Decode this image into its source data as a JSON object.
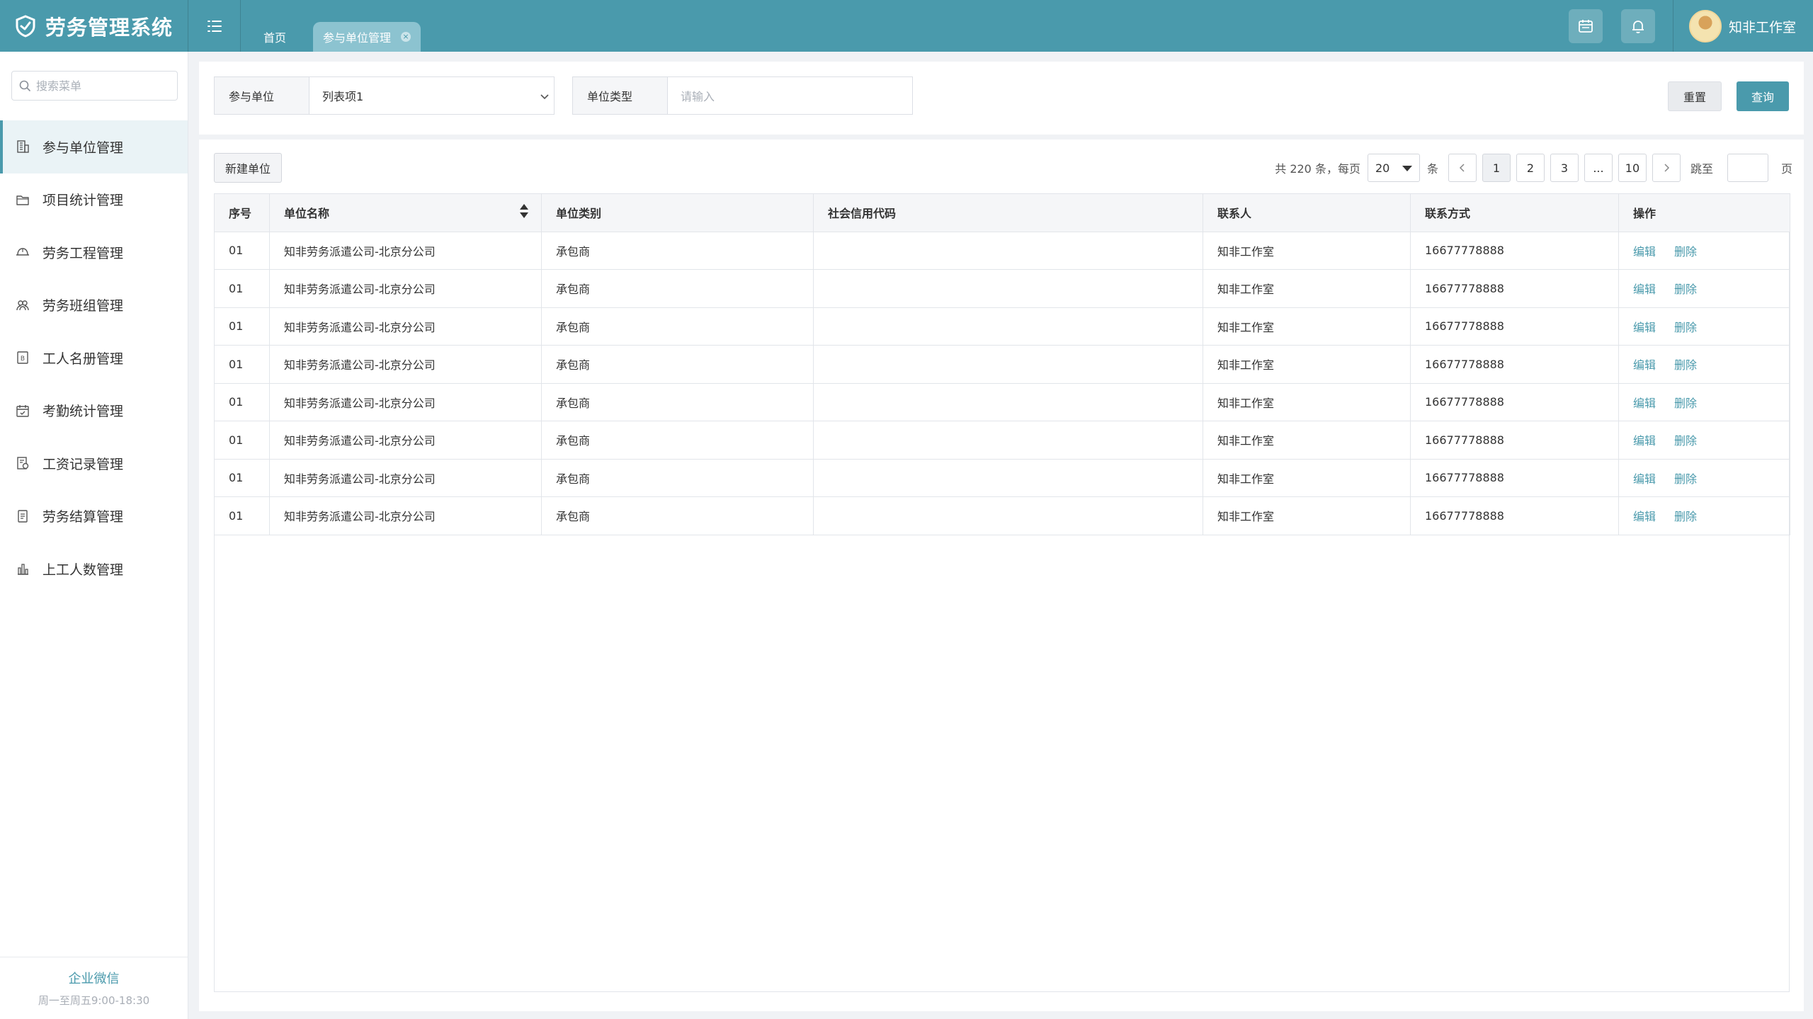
{
  "app": {
    "title": "劳务管理系统",
    "brand_color": "#4a9aac"
  },
  "header": {
    "tabs": [
      {
        "label": "首页",
        "active": false
      },
      {
        "label": "参与单位管理",
        "active": true,
        "close_icon": "close-circle-icon"
      }
    ],
    "icons": [
      "calendar-icon",
      "bell-icon"
    ],
    "user": {
      "name": "知非工作室"
    }
  },
  "sidebar": {
    "search_placeholder": "搜索菜单",
    "items": [
      {
        "label": "参与单位管理",
        "icon": "building-icon",
        "active": true
      },
      {
        "label": "项目统计管理",
        "icon": "folder-icon"
      },
      {
        "label": "劳务工程管理",
        "icon": "hard-hat-icon"
      },
      {
        "label": "劳务班组管理",
        "icon": "team-icon"
      },
      {
        "label": "工人名册管理",
        "icon": "roster-icon"
      },
      {
        "label": "考勤统计管理",
        "icon": "calendar-check-icon"
      },
      {
        "label": "工资记录管理",
        "icon": "payroll-icon"
      },
      {
        "label": "劳务结算管理",
        "icon": "document-icon"
      },
      {
        "label": "上工人数管理",
        "icon": "bar-chart-icon"
      }
    ],
    "footer": {
      "title": "企业微信",
      "hours": "周一至周五9:00-18:30"
    }
  },
  "filters": {
    "unit_label": "参与单位",
    "unit_value": "列表项1",
    "type_label": "单位类型",
    "type_placeholder": "请输入",
    "reset_label": "重置",
    "query_label": "查询"
  },
  "toolbar": {
    "new_label": "新建单位"
  },
  "pagination": {
    "total_prefix": "共 220 条，每页",
    "page_size": "20",
    "unit": "条",
    "pages": [
      "1",
      "2",
      "3",
      "...",
      "10"
    ],
    "current_page": "1",
    "jump_label": "跳至",
    "page_suffix": "页"
  },
  "table": {
    "columns": [
      "序号",
      "单位名称",
      "单位类别",
      "社会信用代码",
      "联系人",
      "联系方式",
      "操作"
    ],
    "edit_label": "编辑",
    "delete_label": "删除",
    "rows": [
      {
        "no": "01",
        "name": "知非劳务派遣公司-北京分公司",
        "category": "承包商",
        "credit_code": "",
        "contact": "知非工作室",
        "phone": "16677778888"
      },
      {
        "no": "01",
        "name": "知非劳务派遣公司-北京分公司",
        "category": "承包商",
        "credit_code": "",
        "contact": "知非工作室",
        "phone": "16677778888"
      },
      {
        "no": "01",
        "name": "知非劳务派遣公司-北京分公司",
        "category": "承包商",
        "credit_code": "",
        "contact": "知非工作室",
        "phone": "16677778888"
      },
      {
        "no": "01",
        "name": "知非劳务派遣公司-北京分公司",
        "category": "承包商",
        "credit_code": "",
        "contact": "知非工作室",
        "phone": "16677778888"
      },
      {
        "no": "01",
        "name": "知非劳务派遣公司-北京分公司",
        "category": "承包商",
        "credit_code": "",
        "contact": "知非工作室",
        "phone": "16677778888"
      },
      {
        "no": "01",
        "name": "知非劳务派遣公司-北京分公司",
        "category": "承包商",
        "credit_code": "",
        "contact": "知非工作室",
        "phone": "16677778888"
      },
      {
        "no": "01",
        "name": "知非劳务派遣公司-北京分公司",
        "category": "承包商",
        "credit_code": "",
        "contact": "知非工作室",
        "phone": "16677778888"
      },
      {
        "no": "01",
        "name": "知非劳务派遣公司-北京分公司",
        "category": "承包商",
        "credit_code": "",
        "contact": "知非工作室",
        "phone": "16677778888"
      }
    ]
  }
}
